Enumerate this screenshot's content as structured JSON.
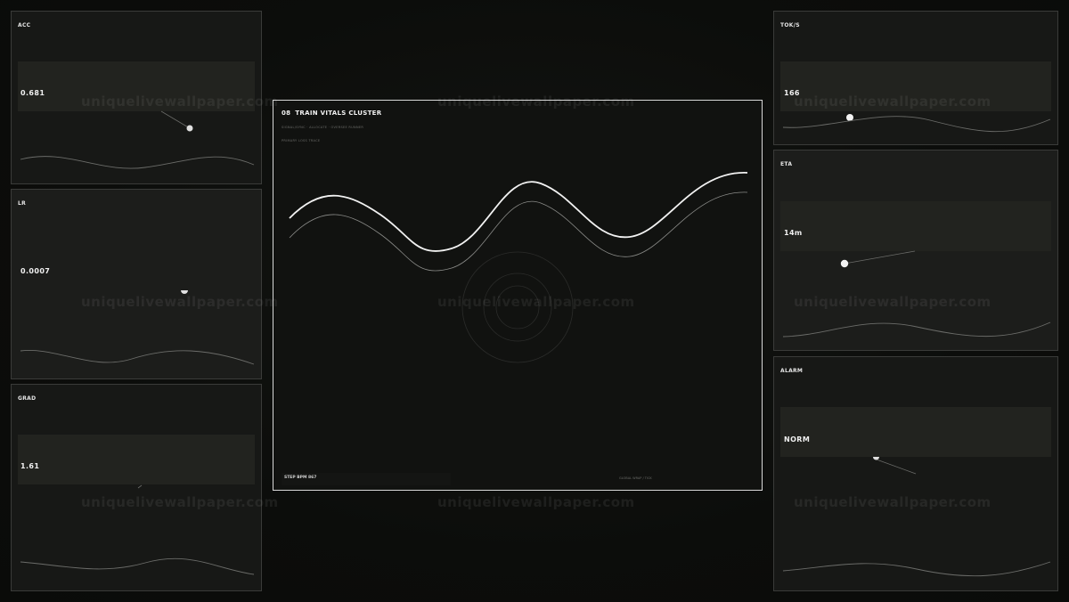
{
  "panels": {
    "acc": {
      "label": "ACC",
      "value": "0.681"
    },
    "lr": {
      "label": "LR",
      "value": "0.0007"
    },
    "grad": {
      "label": "GRAD",
      "value": "1.61"
    },
    "toks": {
      "label": "TOK/S",
      "value": "166"
    },
    "eta": {
      "label": "ETA",
      "value": "14m"
    },
    "alarm": {
      "label": "ALARM",
      "value": "NORM"
    }
  },
  "center": {
    "number": "08",
    "title": "TRAIN VITALS CLUSTER",
    "subtitle": "SIGNAL/SYNC · ALLOCATE · OVERSEE RUNNER",
    "trace_label": "PRIMARY LOSS TRACE",
    "step_text": "STEP BPM 867",
    "global_text": "GLOBAL WRAP / TICK"
  },
  "watermark": "uniquelivewallpaper.com",
  "colors": {
    "background": "#0c0d0b",
    "panel": "#171816",
    "panel_band": "#22231f",
    "border": "#3a3b39",
    "accent": "#ffffff"
  }
}
